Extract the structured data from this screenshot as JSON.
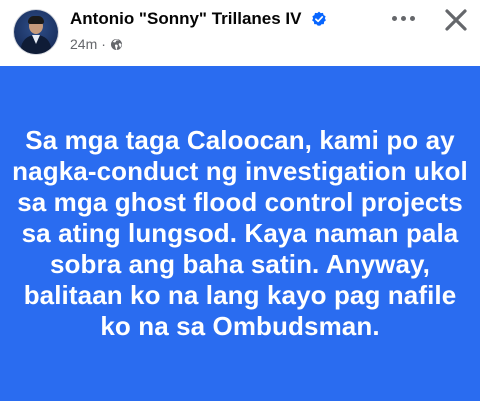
{
  "post": {
    "author_name": "Antonio \"Sonny\" Trillanes IV",
    "verified_icon": "verified-badge-icon",
    "timestamp": "24m",
    "separator": "·",
    "privacy_icon": "globe-icon",
    "more_icon": "more-options-icon",
    "close_icon": "close-icon",
    "background_color": "#2a6cf0",
    "text_color": "#ffffff",
    "text": "Sa mga taga Caloocan, kami po ay nagka-conduct ng investigation ukol sa mga ghost flood control projects sa ating lungsod. Kaya naman pala sobra ang baha satin. Anyway, balitaan ko na lang kayo pag nafile ko na sa Ombudsman."
  },
  "colors": {
    "verified_blue": "#0866ff",
    "meta_gray": "#65676b"
  }
}
